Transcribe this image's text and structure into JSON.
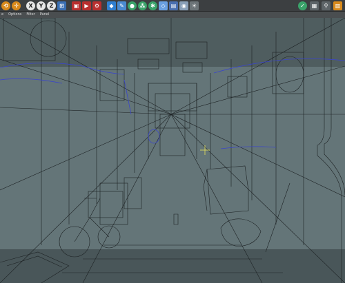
{
  "toolbar": {
    "buttons": [
      {
        "icon": "undo-icon",
        "color": "#d98a1c"
      },
      {
        "icon": "move-icon",
        "color": "#d98a1c"
      },
      {
        "icon": "axis-x-icon",
        "label": "X"
      },
      {
        "icon": "axis-y-icon",
        "label": "Y"
      },
      {
        "icon": "axis-z-icon",
        "label": "Z"
      },
      {
        "icon": "coordinate-system-icon",
        "color": "#3a6fb3"
      },
      {
        "icon": "render-region-icon",
        "color": "#b92f2f"
      },
      {
        "icon": "render-view-icon",
        "color": "#b92f2f"
      },
      {
        "icon": "render-settings-icon",
        "color": "#b92f2f"
      },
      {
        "icon": "cube-icon",
        "color": "#2f7fd0"
      },
      {
        "icon": "pen-icon",
        "color": "#4a8bd0"
      },
      {
        "icon": "subdivision-icon",
        "color": "#3aa36a"
      },
      {
        "icon": "clone-icon",
        "color": "#3aa36a"
      },
      {
        "icon": "deformer-icon",
        "color": "#3aa36a"
      },
      {
        "icon": "field-icon",
        "color": "#6aa0e0"
      },
      {
        "icon": "scene-icon",
        "color": "#4a6fb0"
      },
      {
        "icon": "camera-icon",
        "color": "#8aa0b8"
      },
      {
        "icon": "light-icon",
        "color": "#c8c8c8"
      }
    ],
    "right_buttons": [
      {
        "icon": "snap-icon",
        "color": "#3aa36a"
      },
      {
        "icon": "workplane-icon",
        "color": "#9aa3a8"
      },
      {
        "icon": "pin-icon",
        "color": "#9aa3a8"
      },
      {
        "icon": "layout-icon",
        "color": "#d98a1c"
      }
    ]
  },
  "menu": {
    "items": [
      "e",
      "Options",
      "Filter",
      "Panel"
    ]
  },
  "viewport": {
    "background": "#647578",
    "wire_color": "#1d2224",
    "spline_color": "#3b46c8"
  }
}
